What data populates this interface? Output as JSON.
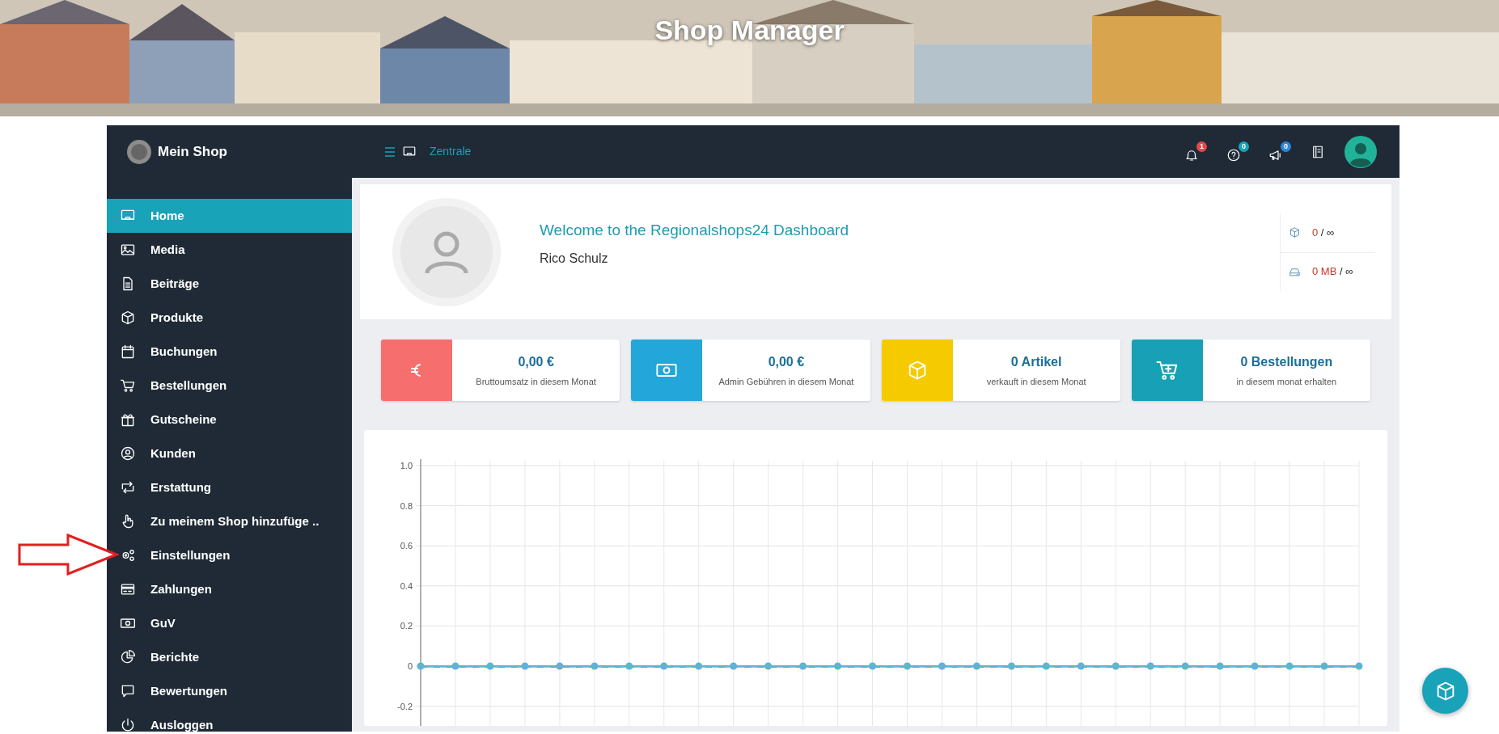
{
  "banner": {
    "title": "Shop Manager"
  },
  "topbar": {
    "shop_name": "Mein Shop",
    "breadcrumb": "Zentrale",
    "notifications": [
      {
        "count": "1",
        "color": "#e5474b"
      },
      {
        "count": "0",
        "color": "#17a2b8"
      },
      {
        "count": "0",
        "color": "#2f86d6"
      }
    ]
  },
  "sidebar": {
    "items": [
      {
        "label": "Home",
        "selected": true
      },
      {
        "label": "Media",
        "selected": false
      },
      {
        "label": "Beiträge",
        "selected": false
      },
      {
        "label": "Produkte",
        "selected": false
      },
      {
        "label": "Buchungen",
        "selected": false
      },
      {
        "label": "Bestellungen",
        "selected": false
      },
      {
        "label": "Gutscheine",
        "selected": false
      },
      {
        "label": "Kunden",
        "selected": false
      },
      {
        "label": "Erstattung",
        "selected": false
      },
      {
        "label": "Zu meinem Shop hinzufüge ..",
        "selected": false
      },
      {
        "label": "Einstellungen",
        "selected": false
      },
      {
        "label": "Zahlungen",
        "selected": false
      },
      {
        "label": "GuV",
        "selected": false
      },
      {
        "label": "Berichte",
        "selected": false
      },
      {
        "label": "Bewertungen",
        "selected": false
      },
      {
        "label": "Ausloggen",
        "selected": false
      }
    ]
  },
  "welcome": {
    "title": "Welcome to the Regionalshops24 Dashboard",
    "user": "Rico Schulz",
    "limits": [
      {
        "used": "0",
        "rest": "/ ∞"
      },
      {
        "used": "0 MB",
        "rest": "/ ∞"
      }
    ]
  },
  "stats": [
    {
      "value": "0,00 €",
      "caption": "Bruttoumsatz in diesem Monat",
      "color": "#f76e6e"
    },
    {
      "value": "0,00 €",
      "caption": "Admin Gebühren in diesem Monat",
      "color": "#23a6d9"
    },
    {
      "value": "0 Artikel",
      "caption": "verkauft in diesem Monat",
      "color": "#f5cb00"
    },
    {
      "value": "0 Bestellungen",
      "caption": "in diesem monat erhalten",
      "color": "#18a0b6"
    }
  ],
  "chart": {
    "chart_data": {
      "type": "line",
      "grid": true,
      "ylim": [
        -0.3,
        1.0
      ],
      "yticks": [
        -0.2,
        0,
        0.2,
        0.4,
        0.6,
        0.8,
        {
          "value": 1.0,
          "label": "1.0"
        }
      ],
      "series": [
        {
          "color": "#6bb36b",
          "line_style": "dashed",
          "values": [
            0,
            0,
            0,
            0,
            0,
            0,
            0,
            0,
            0,
            0,
            0,
            0,
            0,
            0,
            0,
            0,
            0,
            0,
            0,
            0,
            0,
            0,
            0,
            0,
            0,
            0,
            0,
            0
          ]
        },
        {
          "color": "#d9c23a",
          "line_style": "dashed",
          "values": [
            0,
            0,
            0,
            0,
            0,
            0,
            0,
            0,
            0,
            0,
            0,
            0,
            0,
            0,
            0,
            0,
            0,
            0,
            0,
            0,
            0,
            0,
            0,
            0,
            0,
            0,
            0,
            0
          ]
        },
        {
          "color": "#5fb4d0",
          "line_style": "solid",
          "marker": "circle",
          "values": [
            0,
            0,
            0,
            0,
            0,
            0,
            0,
            0,
            0,
            0,
            0,
            0,
            0,
            0,
            0,
            0,
            0,
            0,
            0,
            0,
            0,
            0,
            0,
            0,
            0,
            0,
            0,
            0
          ]
        }
      ]
    }
  }
}
